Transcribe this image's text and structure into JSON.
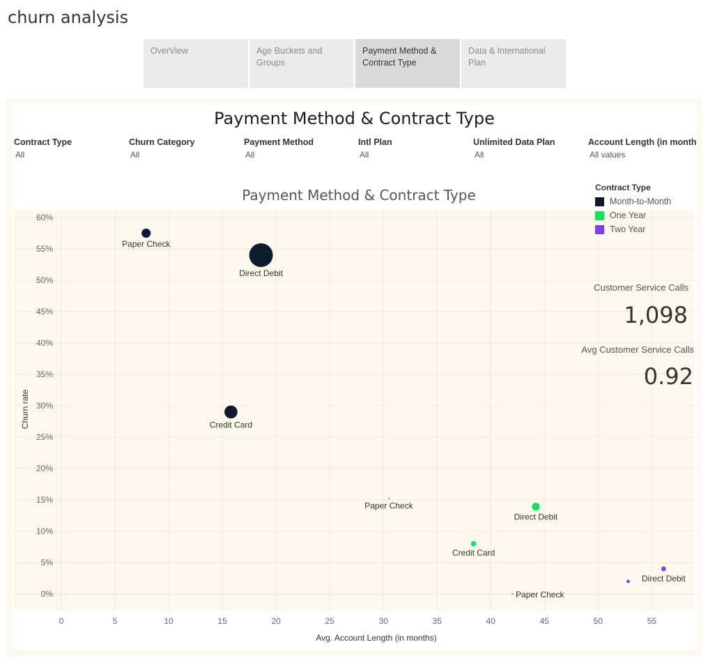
{
  "app": {
    "title": "churn analysis"
  },
  "tabs": [
    {
      "label": "OverView",
      "active": false
    },
    {
      "label": "Age Buckets and Groups",
      "active": false
    },
    {
      "label": "Payment Method & Contract Type",
      "active": true
    },
    {
      "label": "Data & International Plan",
      "active": false
    }
  ],
  "dashboard": {
    "title": "Payment Method & Contract Type"
  },
  "filters": [
    {
      "label": "Contract Type",
      "value": "All"
    },
    {
      "label": "Churn Category",
      "value": "All"
    },
    {
      "label": "Payment Method",
      "value": "All"
    },
    {
      "label": "Intl Plan",
      "value": "All"
    },
    {
      "label": "Unlimited Data Plan",
      "value": "All"
    },
    {
      "label": "Account Length (in month..",
      "value": "All values"
    }
  ],
  "legend": {
    "title": "Contract Type",
    "items": [
      {
        "label": "Month-to-Month",
        "color": "#0d1b2e"
      },
      {
        "label": "One Year",
        "color": "#10e35c"
      },
      {
        "label": "Two Year",
        "color": "#7b3ff2"
      }
    ]
  },
  "kpis": [
    {
      "label": "Customer Service Calls",
      "value": "1,098"
    },
    {
      "label": "Avg Customer Service Calls",
      "value": "0.92"
    }
  ],
  "chart_data": {
    "type": "scatter",
    "title": "Payment Method & Contract Type",
    "xlabel": "Avg. Account Length (in months)",
    "ylabel": "Churn rate",
    "xlim": [
      0,
      59
    ],
    "ylim": [
      -3,
      61
    ],
    "x_ticks": [
      0,
      5,
      10,
      15,
      20,
      25,
      30,
      35,
      40,
      45,
      50,
      55
    ],
    "y_ticks": [
      0,
      5,
      10,
      15,
      20,
      25,
      30,
      35,
      40,
      45,
      50,
      55,
      60
    ],
    "y_tick_suffix": "%",
    "grid": true,
    "size_encoding": "relative bubble size",
    "series": [
      {
        "name": "Month-to-Month",
        "color": "#0d1b2e",
        "points": [
          {
            "label": "Paper Check",
            "x": 7.9,
            "y": 57.5,
            "size": 0.15
          },
          {
            "label": "Direct Debit",
            "x": 18.6,
            "y": 54.0,
            "size": 1.0
          },
          {
            "label": "Credit Card",
            "x": 15.8,
            "y": 29.0,
            "size": 0.3
          }
        ]
      },
      {
        "name": "One Year",
        "color": "#10e35c",
        "points": [
          {
            "label": "Paper Check",
            "x": 30.5,
            "y": 15.2,
            "size": 0.005
          },
          {
            "label": "Direct Debit",
            "x": 44.2,
            "y": 13.9,
            "size": 0.11
          },
          {
            "label": "Credit Card",
            "x": 38.4,
            "y": 8.0,
            "size": 0.05
          }
        ]
      },
      {
        "name": "Two Year",
        "color": "#7b3ff2",
        "points": [
          {
            "label": "Direct Debit",
            "x": 56.1,
            "y": 4.0,
            "size": 0.04
          },
          {
            "label": "",
            "x": 52.8,
            "y": 2.0,
            "size": 0.02
          },
          {
            "label": "Paper Check",
            "x": 42.0,
            "y": 0.0,
            "size": 0.002
          }
        ]
      }
    ]
  }
}
